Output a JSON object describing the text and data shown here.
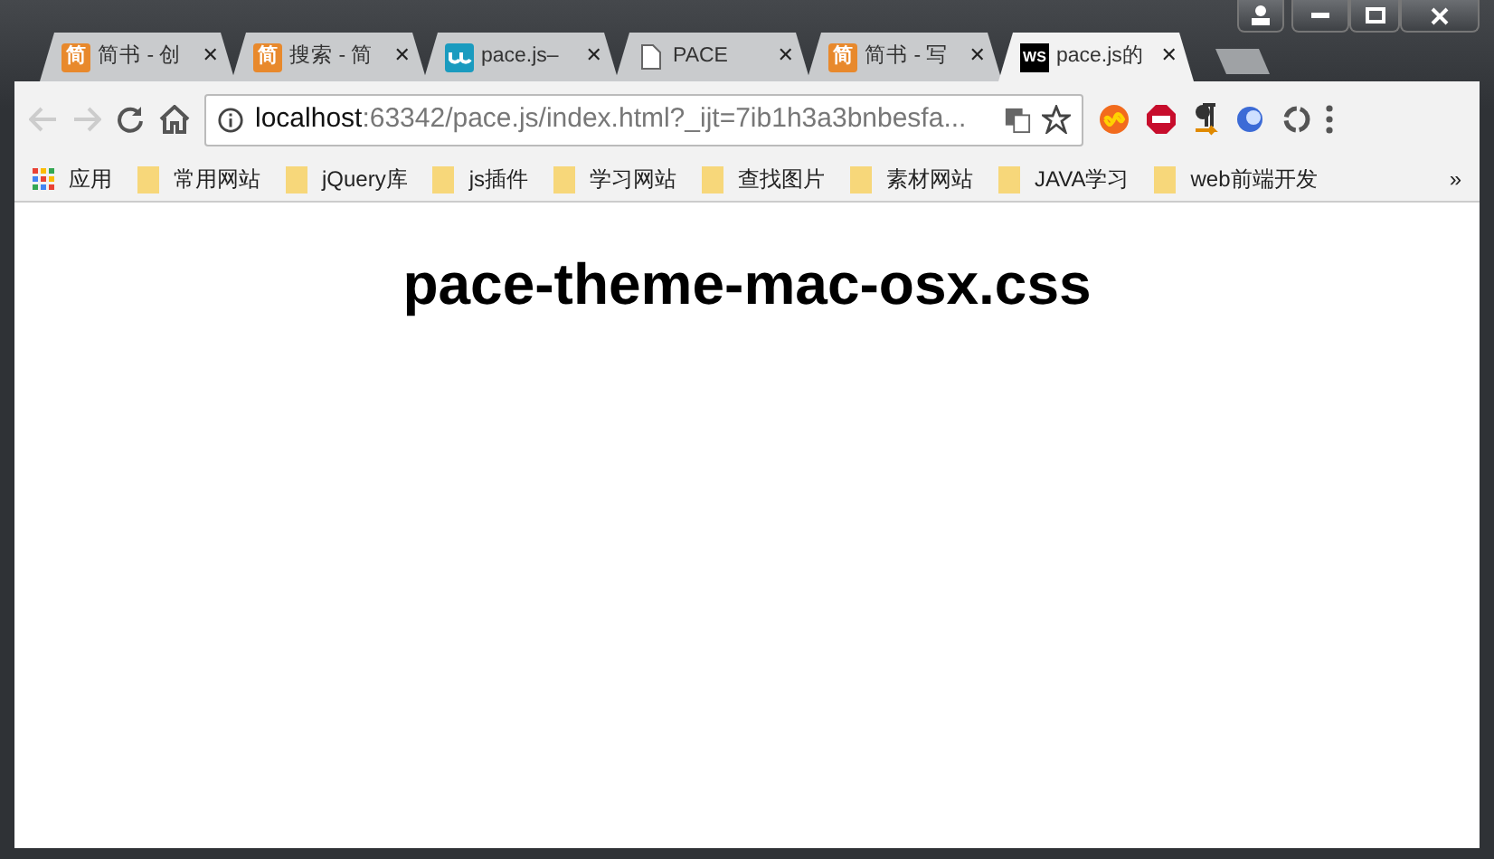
{
  "tabs": [
    {
      "kind": "jianshu",
      "icon_text": "简",
      "title": "简书 - 创",
      "selected": false
    },
    {
      "kind": "jianshu",
      "icon_text": "简",
      "title": "搜索 - 简",
      "selected": false
    },
    {
      "kind": "wj",
      "title": "pace.js–",
      "selected": false
    },
    {
      "kind": "page",
      "title": "PACE",
      "selected": false
    },
    {
      "kind": "jianshu",
      "icon_text": "简",
      "title": "简书 - 写",
      "selected": false
    },
    {
      "kind": "ws",
      "icon_text": "WS",
      "title": "pace.js的",
      "selected": true
    }
  ],
  "close_glyph": "✕",
  "address": {
    "host": "localhost",
    "rest": ":63342/pace.js/index.html?_ijt=7ib1h3a3bnbesfa..."
  },
  "bookmarks": [
    {
      "kind": "apps",
      "label": "应用"
    },
    {
      "kind": "folder",
      "label": "常用网站"
    },
    {
      "kind": "folder",
      "label": "jQuery库"
    },
    {
      "kind": "folder",
      "label": "js插件"
    },
    {
      "kind": "folder",
      "label": "学习网站"
    },
    {
      "kind": "folder",
      "label": "查找图片"
    },
    {
      "kind": "folder",
      "label": "素材网站"
    },
    {
      "kind": "folder",
      "label": "JAVA学习"
    },
    {
      "kind": "folder",
      "label": "web前端开发"
    }
  ],
  "bookmarks_more": "»",
  "page": {
    "heading": "pace-theme-mac-osx.css"
  }
}
